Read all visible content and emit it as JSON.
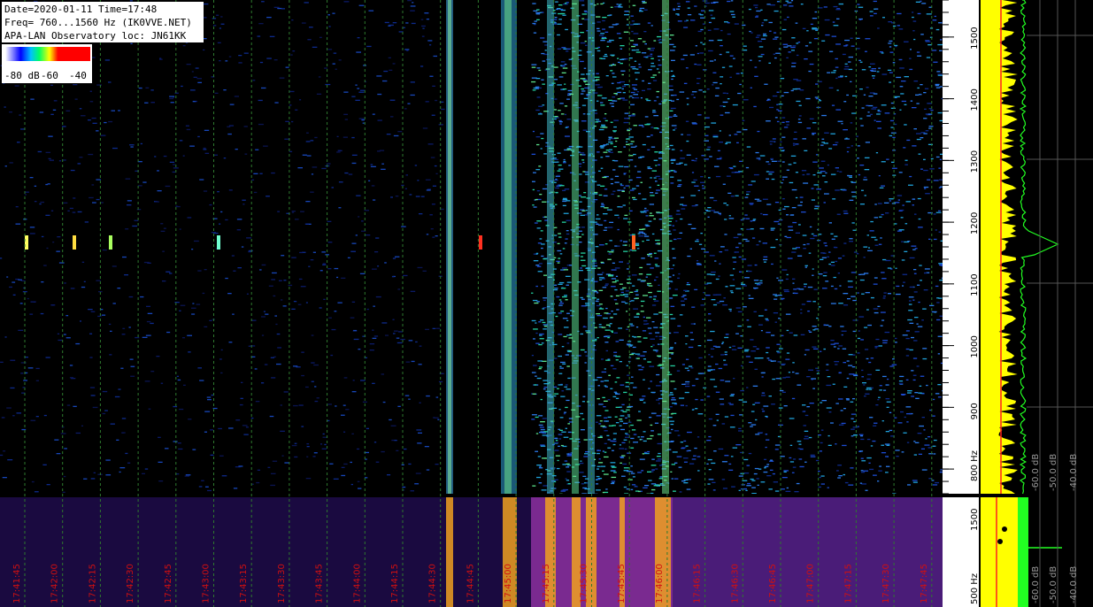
{
  "header": {
    "line1": "Date=2020-01-11 Time=17:48",
    "line2": "Freq= 760...1560 Hz (IK0VVE.NET)",
    "line3": "APA-LAN Observatory loc: JN61KK"
  },
  "legend": {
    "labels": [
      "-80 dB",
      "-60",
      "-40"
    ],
    "colors": [
      "#ffffff",
      "#0000ff",
      "#00c0ff",
      "#00ff66",
      "#ffff00",
      "#ff0000"
    ]
  },
  "freq_axis": {
    "ticks": [
      "800 Hz",
      "900",
      "1000",
      "1100",
      "1200",
      "1300",
      "1400",
      "1500"
    ],
    "tick_values": [
      800,
      900,
      1000,
      1100,
      1200,
      1300,
      1400,
      1500
    ],
    "range": [
      760,
      1560
    ]
  },
  "lower_axis": {
    "ticks": [
      "500 Hz",
      "1500"
    ]
  },
  "spectrum_axis": {
    "labels": [
      "-60.0 dB",
      "-50.0 dB",
      "-40.0 dB"
    ],
    "lower_labels": [
      "-60.0 dB",
      "-50.0 dB",
      "-40.0 dB"
    ]
  },
  "time_labels": [
    "17:41:45",
    "17:42:00",
    "17:42:15",
    "17:42:30",
    "17:42:45",
    "17:43:00",
    "17:43:15",
    "17:43:30",
    "17:43:45",
    "17:44:00",
    "17:44:15",
    "17:44:30",
    "17:44:45",
    "17:45:00",
    "17:45:15",
    "17:45:30",
    "17:45:45",
    "17:46:00",
    "17:46:15",
    "17:46:30",
    "17:46:45",
    "17:47:00",
    "17:47:15",
    "17:47:30",
    "17:47:45"
  ],
  "colors": {
    "background": "#000000",
    "grid_dashes": "#2e7a2e",
    "time_label": "#d01010",
    "yellow_trace": "#ffff00",
    "green_trace": "#22ff22",
    "red_trace": "#ff2020"
  }
}
